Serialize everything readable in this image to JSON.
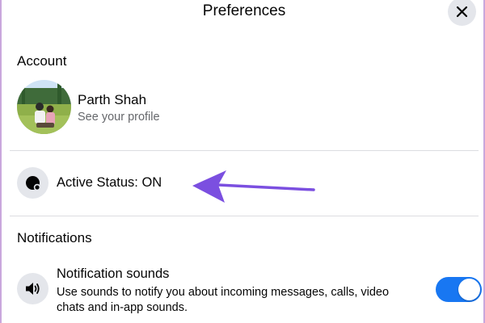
{
  "window": {
    "title": "Preferences"
  },
  "account": {
    "heading": "Account",
    "profile": {
      "name": "Parth Shah",
      "subtitle": "See your profile"
    }
  },
  "active_status": {
    "label": "Active Status: ON"
  },
  "notifications": {
    "heading": "Notifications",
    "sounds": {
      "label": "Notification sounds",
      "description": "Use sounds to notify you about incoming messages, calls, video chats and in-app sounds.",
      "enabled": true
    }
  },
  "icons": {
    "close": "close-icon",
    "active_status": "active-status-icon",
    "sound": "speaker-icon",
    "annotation": "arrow-annotation"
  },
  "colors": {
    "accent": "#1877f2",
    "icon_bg": "#e4e6eb",
    "secondary_text": "#65676b",
    "annotation": "#7b4fe0"
  }
}
